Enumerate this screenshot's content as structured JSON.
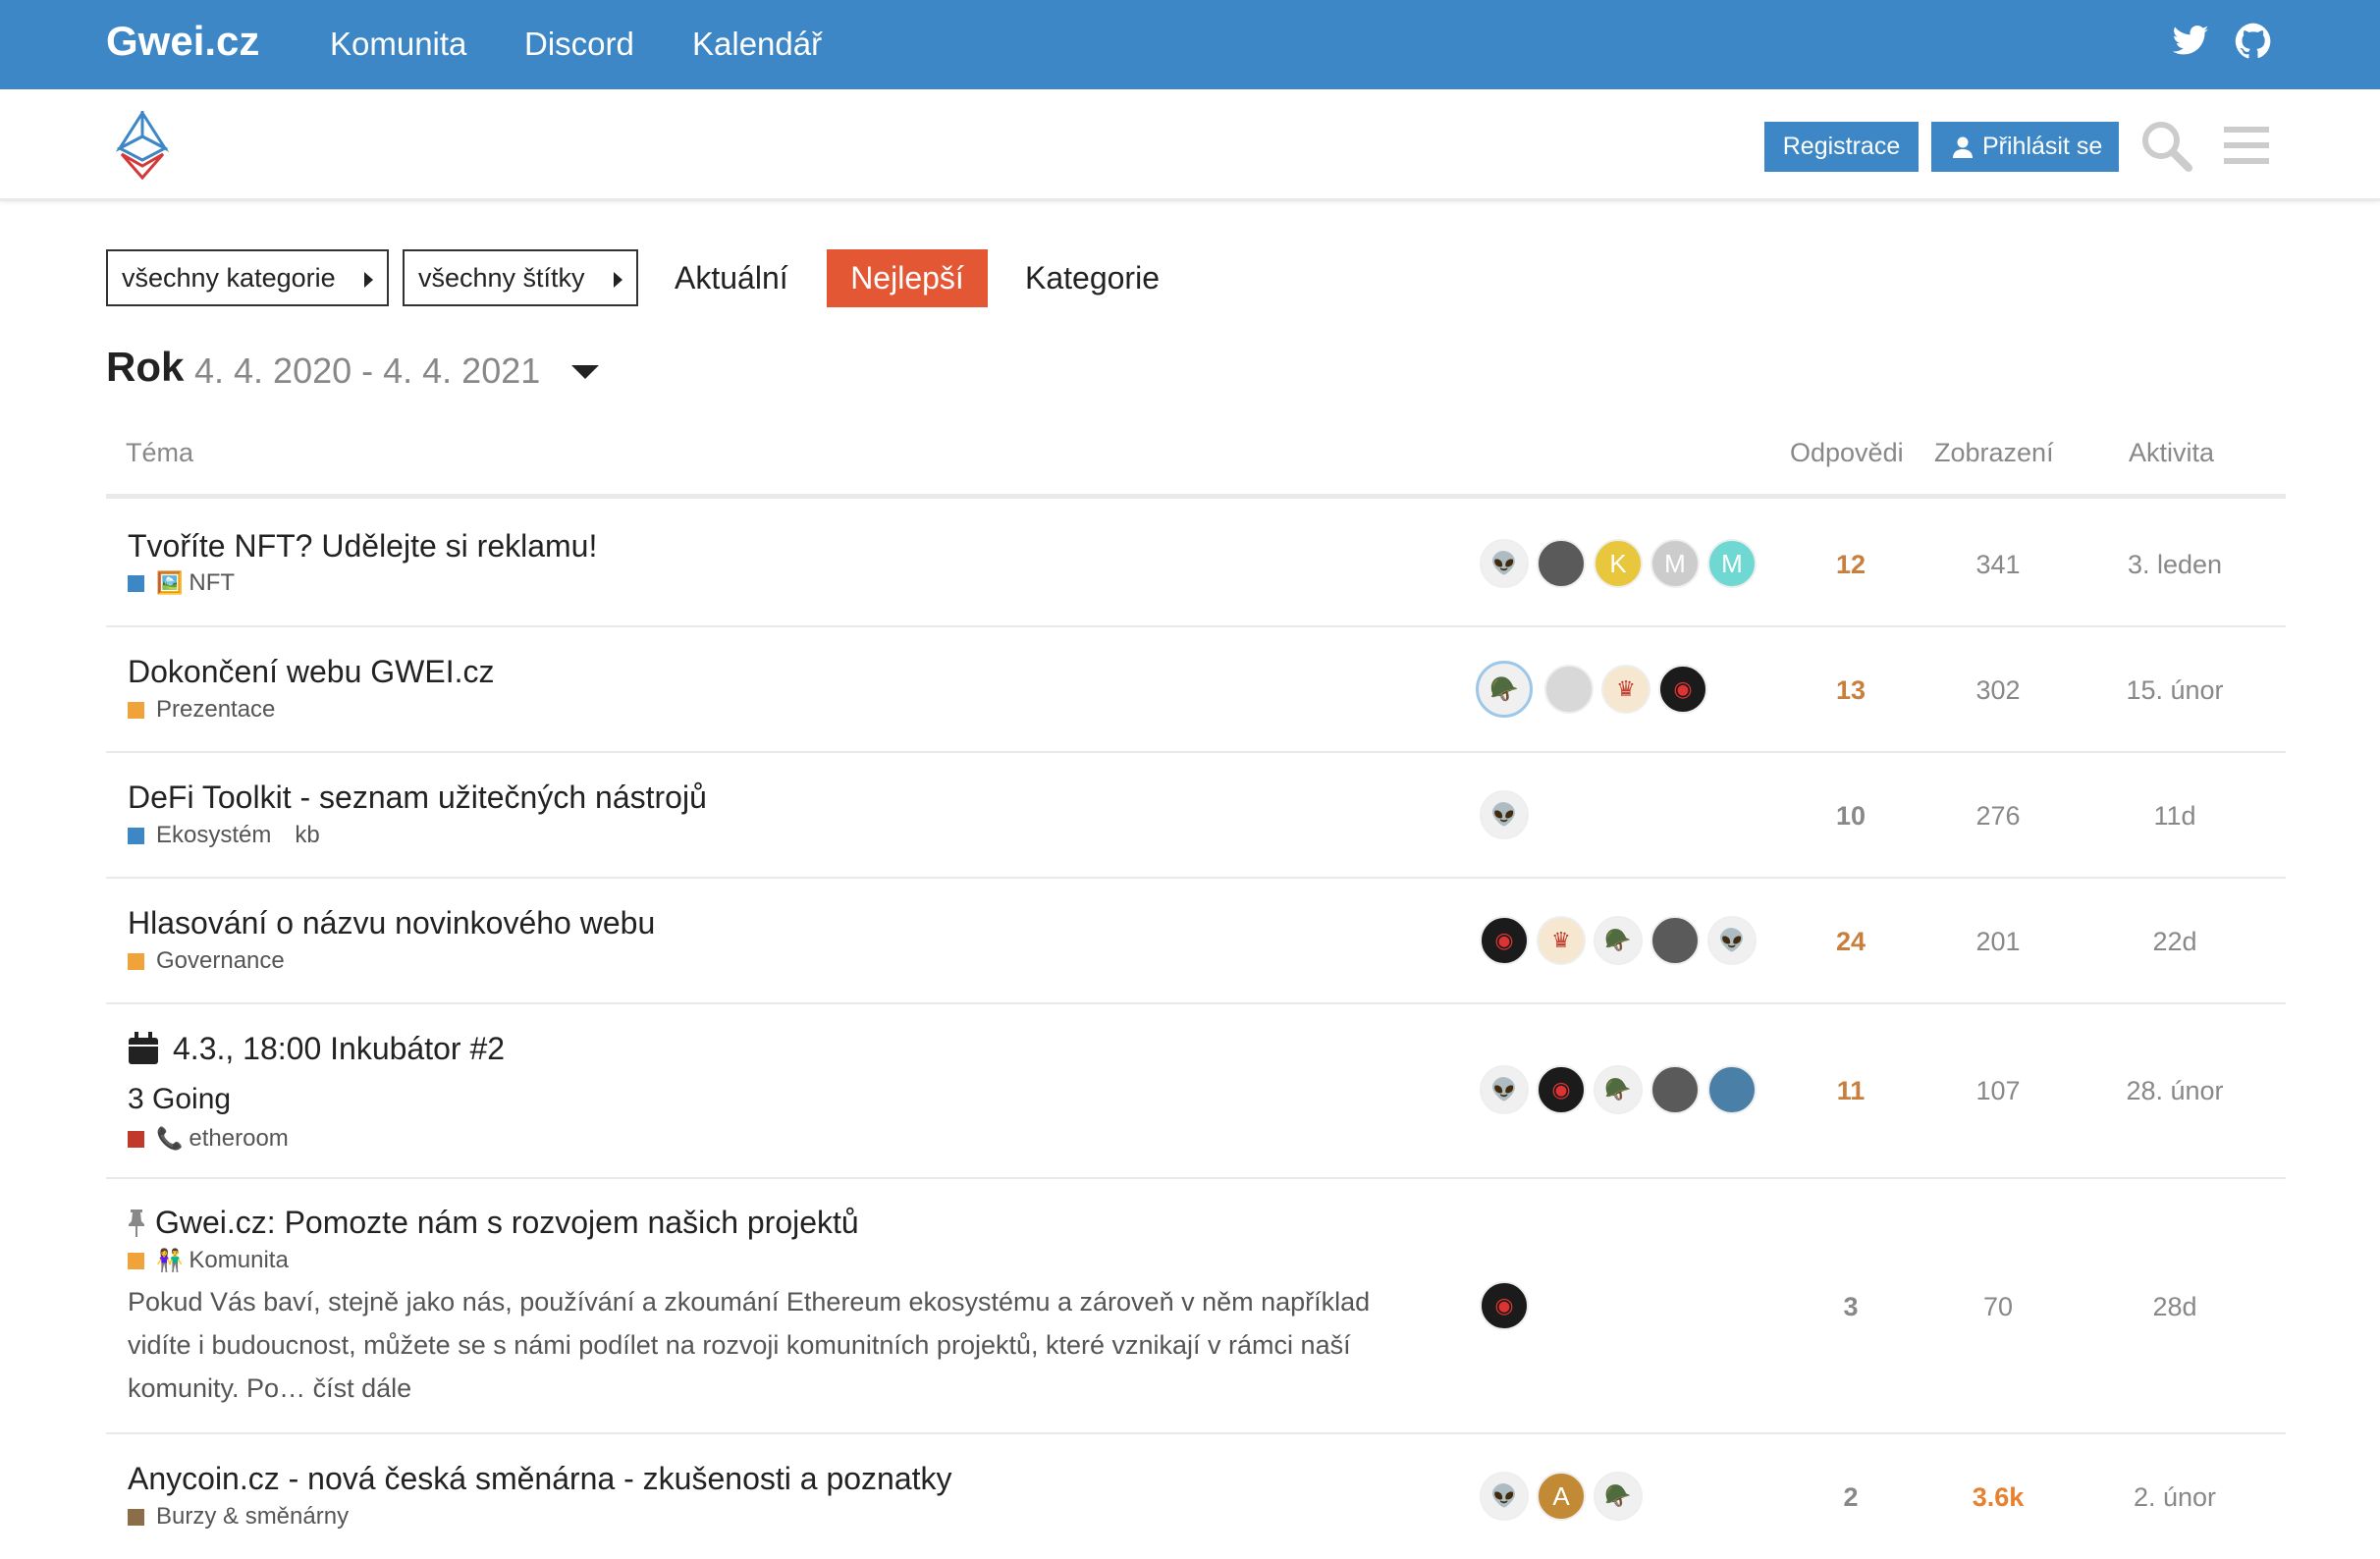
{
  "topbar": {
    "brand": "Gwei.cz",
    "links": [
      "Komunita",
      "Discord",
      "Kalendář"
    ],
    "icons": [
      "twitter-icon",
      "github-icon"
    ],
    "color": "#3d87c7"
  },
  "header": {
    "register_label": "Registrace",
    "login_label": "Přihlásit se",
    "icons": [
      "ethereum-logo",
      "user-icon",
      "search-icon",
      "hamburger-menu-icon"
    ]
  },
  "nav": {
    "categories_dropdown": "všechny kategorie",
    "tags_dropdown": "všechny štítky",
    "tabs": [
      "Aktuální",
      "Nejlepší",
      "Kategorie"
    ],
    "active_tab": "Nejlepší",
    "active_color": "#e45735"
  },
  "period": {
    "title": "Rok",
    "range": "4. 4. 2020 - 4. 4. 2021"
  },
  "table": {
    "headers": {
      "topic": "Téma",
      "replies": "Odpovědi",
      "views": "Zobrazení",
      "activity": "Aktivita"
    },
    "rows": [
      {
        "title": "Tvoříte NFT? Udělejte si reklamu!",
        "category": "NFT",
        "category_color": "#3d87c7",
        "category_emoji": "🖼️",
        "replies": "12",
        "views": "341",
        "activity": "3. leden",
        "avatars": [
          "avatar-alien",
          "avatar-portrait",
          "K",
          "M",
          "M"
        ]
      },
      {
        "title": "Dokončení webu GWEI.cz",
        "category": "Prezentace",
        "category_color": "#f0a33a",
        "replies": "13",
        "views": "302",
        "activity": "15. únor",
        "avatars": [
          "avatar-helmet",
          "avatar-man",
          "avatar-crest",
          "avatar-bear"
        ]
      },
      {
        "title": "DeFi Toolkit - seznam užitečných nástrojů",
        "category": "Ekosystém",
        "category_color": "#3d87c7",
        "tag": "kb",
        "replies": "10",
        "views": "276",
        "activity": "11d",
        "avatars": [
          "avatar-alien"
        ]
      },
      {
        "title": "Hlasování o názvu novinkového webu",
        "category": "Governance",
        "category_color": "#f0a33a",
        "replies": "24",
        "views": "201",
        "activity": "22d",
        "avatars": [
          "avatar-bear",
          "avatar-crest",
          "avatar-helmet",
          "avatar-photo",
          "avatar-alien"
        ]
      },
      {
        "title": "4.3., 18:00 Inkubátor #2",
        "going": "3 Going",
        "category": "etheroom",
        "category_color": "#c0392b",
        "category_emoji": "📞",
        "replies": "11",
        "views": "107",
        "activity": "28. únor",
        "avatars": [
          "avatar-alien",
          "avatar-bear",
          "avatar-helmet",
          "avatar-photo",
          "avatar-blue"
        ]
      },
      {
        "title": "Gwei.cz: Pomozte nám s rozvojem našich projektů",
        "category": "Komunita",
        "category_color": "#f0a33a",
        "category_emoji": "👫",
        "excerpt": "Pokud Vás baví, stejně jako nás, používání a zkoumání Ethereum ekosystému a zároveň v něm například vidíte i budoucnost, můžete se s námi podílet na rozvoji komunitních projektů, které vznikají v rámci naší komunity. Po…",
        "read_more": "číst dále",
        "replies": "3",
        "views": "70",
        "activity": "28d",
        "avatars": [
          "avatar-bear"
        ]
      },
      {
        "title": "Anycoin.cz - nová česká směnárna - zkušenosti a poznatky",
        "category": "Burzy & směnárny",
        "category_color": "#8b6d4a",
        "replies": "2",
        "views": "3.6k",
        "activity": "2. únor",
        "avatars": [
          "avatar-alien",
          "A",
          "avatar-helmet"
        ]
      }
    ]
  }
}
